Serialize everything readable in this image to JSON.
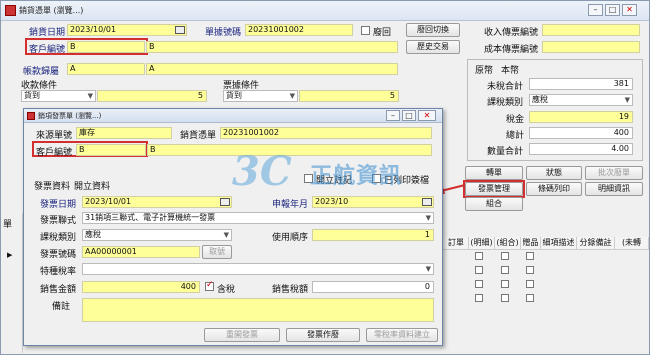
{
  "main": {
    "title": "銷貨憑單 (瀏覽...)",
    "sale_date_label": "銷貨日期",
    "sale_date": "2023/10/01",
    "doc_no_label": "單據號碼",
    "doc_no": "20231001002",
    "void_label": "廢回",
    "void_toggle_btn": "廢回切換",
    "customer_no_label": "客戶編號",
    "customer_code": "B",
    "customer_name": "B",
    "history_btn": "歷史交易",
    "account_label": "帳款歸屬",
    "account_code": "A",
    "account_name": "A",
    "collect_cond_label": "收款條件",
    "collect_cond": "貨到",
    "collect_days": "5",
    "bill_cond_label": "票據條件",
    "bill_cond": "貨到",
    "bill_days": "5",
    "income_voucher_label": "收入傳票編號",
    "cost_voucher_label": "成本傳票編號",
    "currency_orig": "原幣",
    "currency_local": "本幣",
    "untaxed_label": "未稅合計",
    "untaxed": "381",
    "tax_type_label": "課稅類別",
    "tax_type": "應稅",
    "tax_label": "稅金",
    "tax": "19",
    "total_label": "總計",
    "total": "400",
    "qty_total_label": "數量合計",
    "qty_total": "4.00",
    "btn_transfer": "轉單",
    "btn_status": "狀態",
    "btn_batch_void": "批次廢單",
    "btn_invoice_mgmt": "發票管理",
    "btn_barcode": "條碼列印",
    "btn_detail": "明細資訊",
    "btn_combo": "組合",
    "grid_headers": [
      "訂單",
      "(明細)",
      "(組合)",
      "贈品",
      "細項描述",
      "分錄備註",
      "(未轉"
    ],
    "grid_left_label": "單"
  },
  "dialog": {
    "title": "銷項發票單 (瀏覽...)",
    "source_label": "來源單號",
    "source_type": "庫存",
    "source_doc_label": "銷貨憑單",
    "source_doc": "20231001002",
    "customer_label": "客戶編號",
    "customer_code": "B",
    "customer_name": "B",
    "print_after_label": "開立註記",
    "printed_label": "已列印簽檔",
    "invoice_info_label": "發票資料",
    "open_info_label": "開立資料",
    "invoice_date_label": "發票日期",
    "invoice_date": "2023/10/01",
    "report_month_label": "申報年月",
    "report_month": "2023/10",
    "invoice_format_label": "發票聯式",
    "invoice_format": "31銷項三聯式、電子計算機統一發票",
    "tax_type_label": "課稅類別",
    "tax_type": "應稅",
    "use_order_label": "使用順序",
    "use_order": "1",
    "invoice_no_label": "發票號碼",
    "invoice_no": "AA00000001",
    "fetch_label": "取號",
    "special_tax_label": "特種稅率",
    "sales_amount_label": "銷售金額",
    "sales_amount": "400",
    "tax_incl_label": "含稅",
    "sales_tax_label": "銷售稅額",
    "sales_tax": "0",
    "remark_label": "備註",
    "btn_reissue": "重開發票",
    "btn_void_invoice": "發票作廢",
    "btn_zero_tax": "零稅率資料建立"
  },
  "watermark": {
    "brand": "正航資訊",
    "mark": "3C"
  },
  "colors": {
    "field_yellow": "#ffff99",
    "highlight_red": "#d32f2f",
    "label_blue": "#1a237e"
  }
}
